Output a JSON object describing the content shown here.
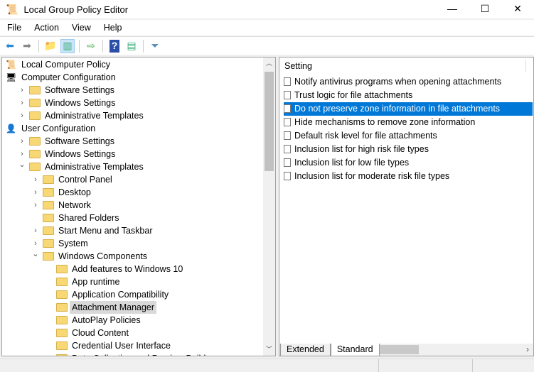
{
  "window": {
    "title": "Local Group Policy Editor",
    "minimize": "—",
    "maximize": "☐",
    "close": "✕"
  },
  "menu": [
    "File",
    "Action",
    "View",
    "Help"
  ],
  "toolbar": [
    "back-icon",
    "forward-icon",
    "up-folder-icon",
    "show-hide-tree-icon",
    "export-list-icon",
    "help-icon",
    "show-action-pane-icon",
    "filter-icon"
  ],
  "tree": [
    {
      "label": "Local Computer Policy",
      "level": 0,
      "icon": "policy-icon",
      "chev": ""
    },
    {
      "label": "Computer Configuration",
      "level": 0,
      "icon": "computer-icon",
      "chev": "expanded"
    },
    {
      "label": "Software Settings",
      "level": 1,
      "icon": "folder-icon",
      "chev": "collapsed"
    },
    {
      "label": "Windows Settings",
      "level": 1,
      "icon": "folder-icon",
      "chev": "collapsed"
    },
    {
      "label": "Administrative Templates",
      "level": 1,
      "icon": "folder-icon",
      "chev": "collapsed"
    },
    {
      "label": "User Configuration",
      "level": 0,
      "icon": "user-icon",
      "chev": "expanded"
    },
    {
      "label": "Software Settings",
      "level": 1,
      "icon": "folder-icon",
      "chev": "collapsed"
    },
    {
      "label": "Windows Settings",
      "level": 1,
      "icon": "folder-icon",
      "chev": "collapsed"
    },
    {
      "label": "Administrative Templates",
      "level": 1,
      "icon": "folder-icon",
      "chev": "expanded"
    },
    {
      "label": "Control Panel",
      "level": 2,
      "icon": "folder-icon",
      "chev": "collapsed"
    },
    {
      "label": "Desktop",
      "level": 2,
      "icon": "folder-icon",
      "chev": "collapsed"
    },
    {
      "label": "Network",
      "level": 2,
      "icon": "folder-icon",
      "chev": "collapsed"
    },
    {
      "label": "Shared Folders",
      "level": 2,
      "icon": "folder-icon",
      "chev": ""
    },
    {
      "label": "Start Menu and Taskbar",
      "level": 2,
      "icon": "folder-icon",
      "chev": "collapsed"
    },
    {
      "label": "System",
      "level": 2,
      "icon": "folder-icon",
      "chev": "collapsed"
    },
    {
      "label": "Windows Components",
      "level": 2,
      "icon": "folder-icon",
      "chev": "expanded"
    },
    {
      "label": "Add features to Windows 10",
      "level": 3,
      "icon": "folder-icon",
      "chev": ""
    },
    {
      "label": "App runtime",
      "level": 3,
      "icon": "folder-icon",
      "chev": ""
    },
    {
      "label": "Application Compatibility",
      "level": 3,
      "icon": "folder-icon",
      "chev": ""
    },
    {
      "label": "Attachment Manager",
      "level": 3,
      "icon": "folder-icon",
      "chev": "",
      "selected": true
    },
    {
      "label": "AutoPlay Policies",
      "level": 3,
      "icon": "folder-icon",
      "chev": ""
    },
    {
      "label": "Cloud Content",
      "level": 3,
      "icon": "folder-icon",
      "chev": ""
    },
    {
      "label": "Credential User Interface",
      "level": 3,
      "icon": "folder-icon",
      "chev": ""
    },
    {
      "label": "Data Collection and Preview Builds",
      "level": 3,
      "icon": "folder-icon",
      "chev": ""
    }
  ],
  "settings": {
    "header": "Setting",
    "items": [
      "Notify antivirus programs when opening attachments",
      "Trust logic for file attachments",
      "Do not preserve zone information in file attachments",
      "Hide mechanisms to remove zone information",
      "Default risk level for file attachments",
      "Inclusion list for high risk file types",
      "Inclusion list for low file types",
      "Inclusion list for moderate risk file types"
    ],
    "selected_index": 2
  },
  "tabs": [
    "Extended",
    "Standard"
  ],
  "active_tab": "Standard",
  "colors": {
    "selection": "#0078d7",
    "tree_selection": "#d9d9d9"
  }
}
